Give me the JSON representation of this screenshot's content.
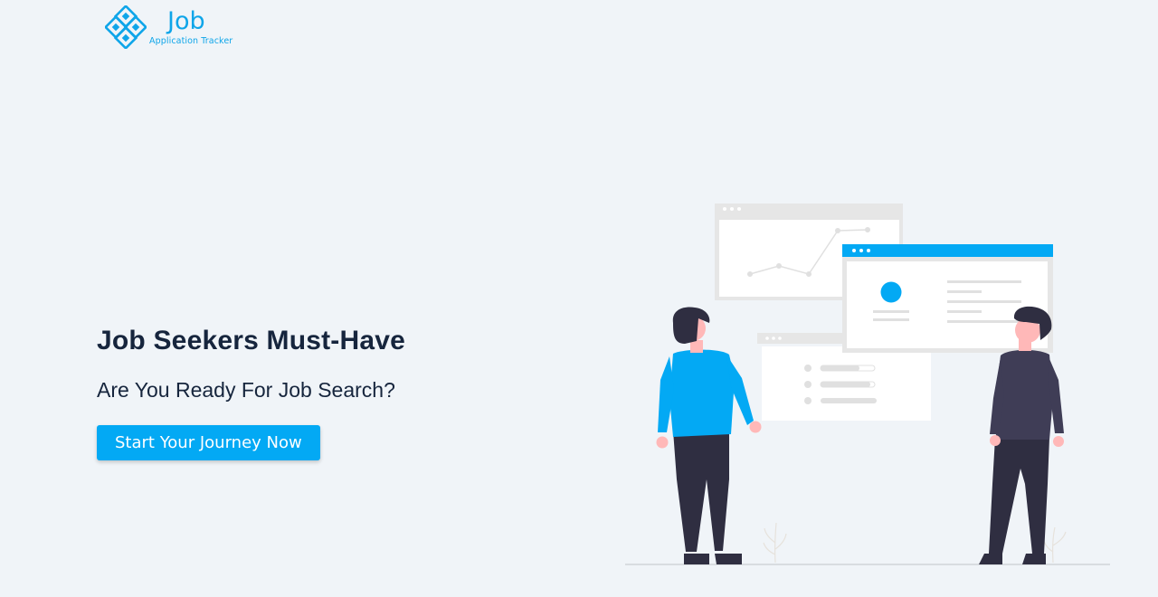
{
  "header": {
    "logo_title": "Job",
    "logo_subtitle": "Application Tracker"
  },
  "hero": {
    "title": "Job Seekers Must-Have",
    "subtitle": "Are You Ready For Job Search?",
    "cta_label": "Start Your Journey Now"
  },
  "colors": {
    "background": "#f0f4f8",
    "accent": "#03a9f4",
    "text": "#16253d",
    "figure_dark": "#3f3d56"
  },
  "icons": {
    "logo": "brand-logo-icon"
  }
}
